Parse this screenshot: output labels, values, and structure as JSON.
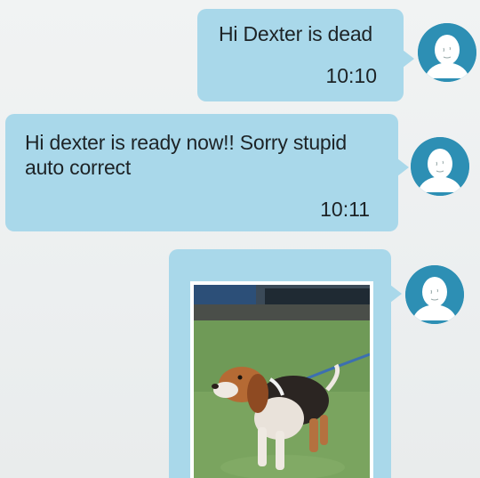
{
  "messages": [
    {
      "text": "Hi Dexter is dead",
      "time": "10:10",
      "avatar_icon": "user-avatar-icon"
    },
    {
      "text": "Hi dexter is ready now!! Sorry stupid auto correct",
      "time": "10:11",
      "avatar_icon": "user-avatar-icon"
    },
    {
      "image": "beagle-on-leash-photo",
      "avatar_icon": "user-avatar-icon"
    }
  ],
  "colors": {
    "bubble": "#a9d8ea",
    "avatar": "#2d8fb4",
    "background": "#eef1f1",
    "text": "#1d2326"
  }
}
